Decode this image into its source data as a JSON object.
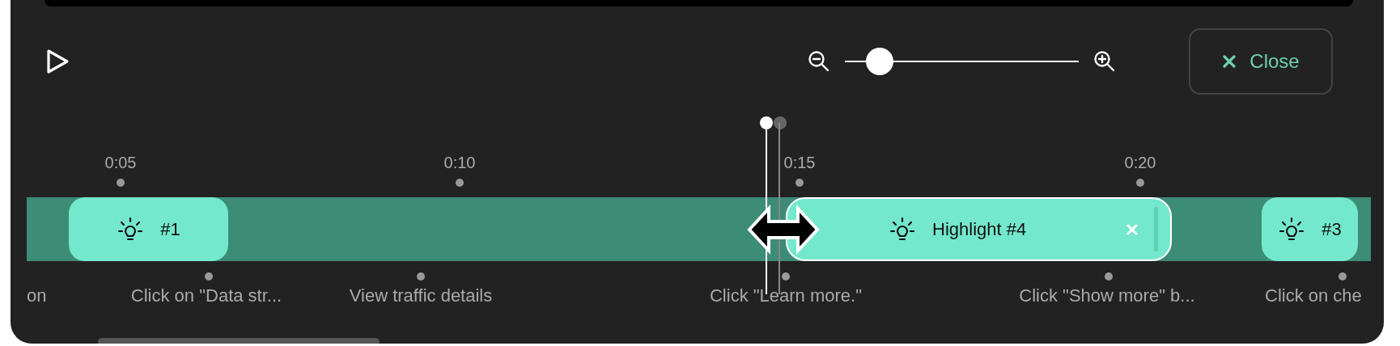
{
  "player": {
    "zoom": {
      "level": 0.15
    },
    "close_button": {
      "label": "Close"
    }
  },
  "timeline": {
    "ticks": [
      "0:05",
      "0:10",
      "0:15",
      "0:20"
    ],
    "highlights": [
      {
        "label": "#1",
        "selected": false
      },
      {
        "label": "Highlight #4",
        "selected": true
      },
      {
        "label": "#3",
        "selected": false
      }
    ],
    "steps": [
      "on",
      "Click on \"Data str...",
      "View traffic details",
      "Click \"Learn more.\"",
      "Click \"Show more\" b...",
      "Click on che"
    ]
  }
}
